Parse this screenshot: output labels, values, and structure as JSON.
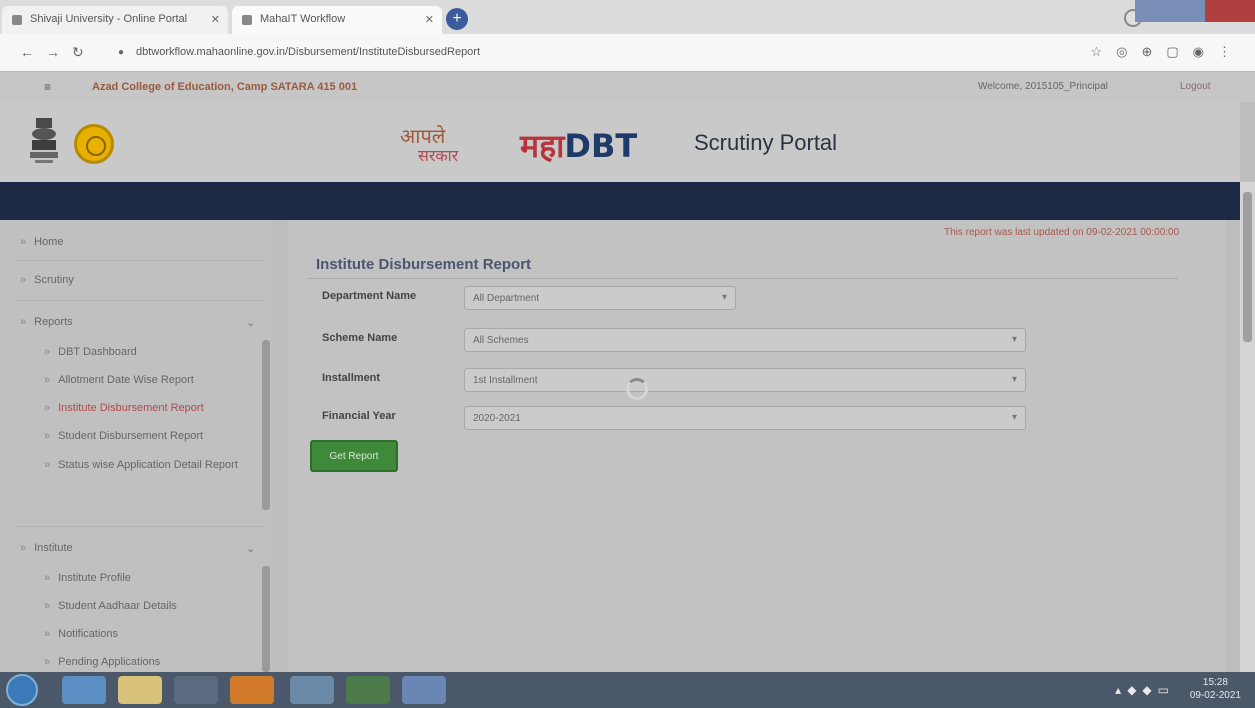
{
  "browser": {
    "tabs": [
      {
        "title": "Shivaji University - Online Portal"
      },
      {
        "title": "MahaIT Workflow"
      }
    ],
    "url": "dbtworkflow.mahaonline.gov.in/Disbursement/InstituteDisbursedReport"
  },
  "topstrip": {
    "college": "Azad College of Education, Camp SATARA 415 001",
    "welcome": "Welcome, 2015105_Principal",
    "logout": "Logout"
  },
  "header": {
    "tagline_top": "आपले",
    "tagline_bottom": "सरकार",
    "brand_maha": "महा",
    "brand_dbt": "DBT",
    "portal_title": "Scrutiny Portal"
  },
  "sidebar": {
    "home": "Home",
    "scrutiny": "Scrutiny",
    "reports": "Reports",
    "report_items": [
      "DBT Dashboard",
      "Allotment Date Wise Report",
      "Institute Disbursement Report",
      "Student Disbursement Report",
      "Status wise Application Detail Report"
    ],
    "institute": "Institute",
    "institute_items": [
      "Institute Profile",
      "Student Aadhaar Details",
      "Notifications",
      "Pending Applications"
    ]
  },
  "content": {
    "notice": "This report was last updated on 09-02-2021 00:00:00",
    "title": "Institute Disbursement Report",
    "fields": {
      "department_label": "Department Name",
      "department_value": "All Department",
      "scheme_label": "Scheme Name",
      "scheme_value": "All Schemes",
      "installment_label": "Installment",
      "installment_value": "1st Installment",
      "year_label": "Financial Year",
      "year_value": "2020-2021"
    },
    "button": "Get Report"
  },
  "taskbar": {
    "time": "15:28",
    "date": "09-02-2021"
  }
}
